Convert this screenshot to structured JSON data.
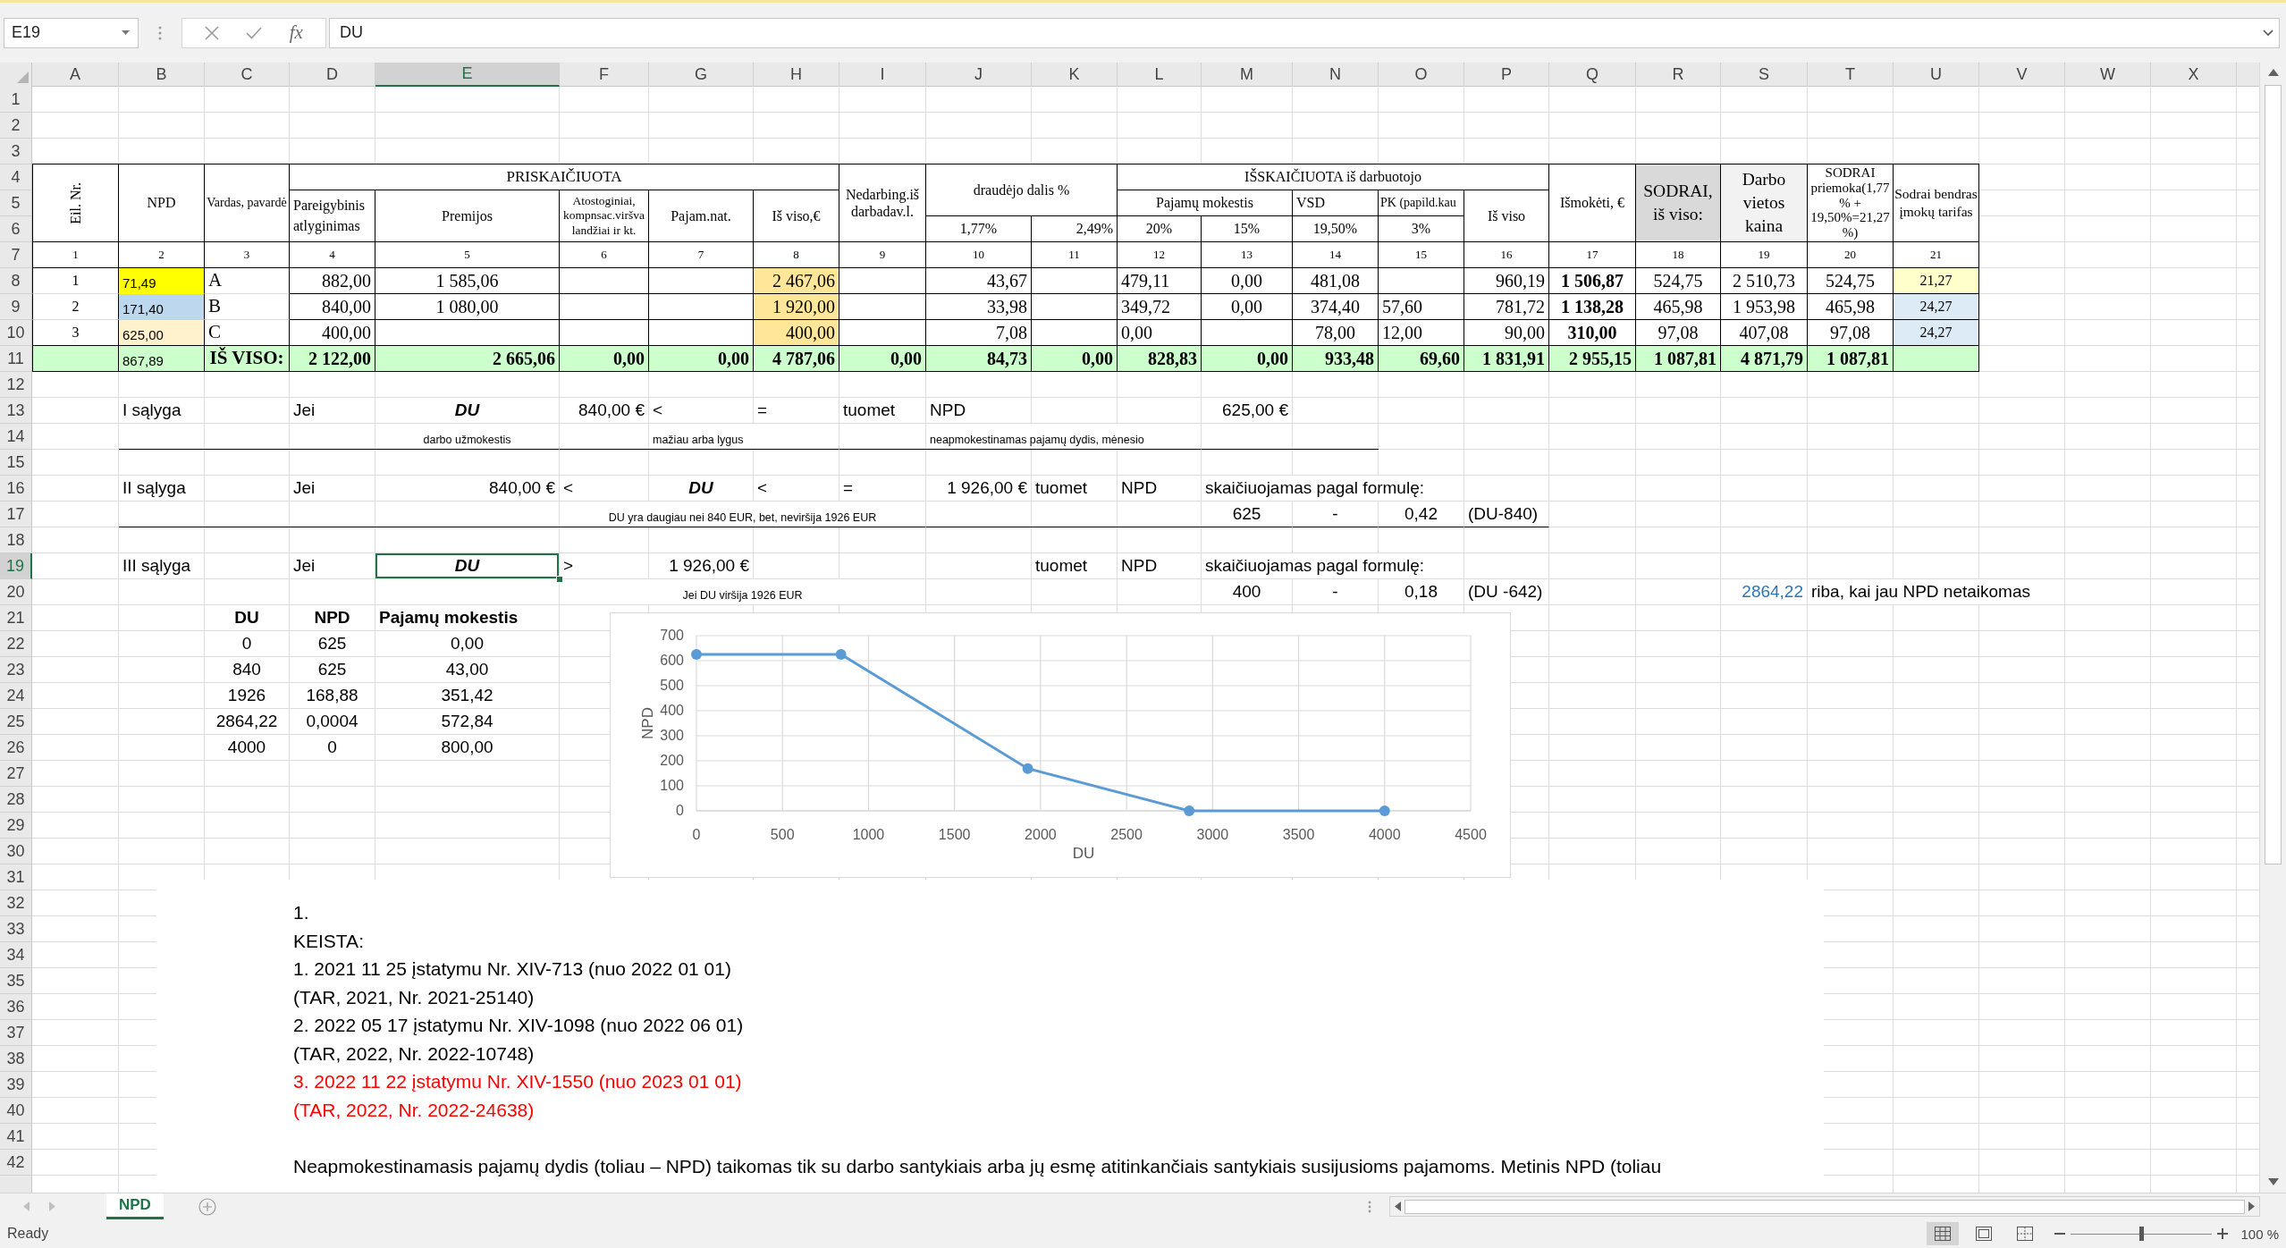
{
  "formula_bar": {
    "name_box": "E19",
    "function_label": "fx",
    "formula": "DU"
  },
  "columns": [
    {
      "label": "A",
      "selected": false
    },
    {
      "label": "B",
      "selected": false
    },
    {
      "label": "C",
      "selected": false
    },
    {
      "label": "D",
      "selected": false
    },
    {
      "label": "E",
      "selected": true
    },
    {
      "label": "F",
      "selected": false
    },
    {
      "label": "G",
      "selected": false
    },
    {
      "label": "H",
      "selected": false
    },
    {
      "label": "I",
      "selected": false
    },
    {
      "label": "J",
      "selected": false
    },
    {
      "label": "K",
      "selected": false
    },
    {
      "label": "L",
      "selected": false
    },
    {
      "label": "M",
      "selected": false
    },
    {
      "label": "N",
      "selected": false
    },
    {
      "label": "O",
      "selected": false
    },
    {
      "label": "P",
      "selected": false
    },
    {
      "label": "Q",
      "selected": false
    },
    {
      "label": "R",
      "selected": false
    },
    {
      "label": "S",
      "selected": false
    },
    {
      "label": "T",
      "selected": false
    },
    {
      "label": "U",
      "selected": false
    },
    {
      "label": "V",
      "selected": false
    },
    {
      "label": "W",
      "selected": false
    },
    {
      "label": "X",
      "selected": false
    }
  ],
  "rows": [
    {
      "label": "1",
      "selected": false
    },
    {
      "label": "2",
      "selected": false
    },
    {
      "label": "3",
      "selected": false
    },
    {
      "label": "4",
      "selected": false
    },
    {
      "label": "5",
      "selected": false
    },
    {
      "label": "6",
      "selected": false
    },
    {
      "label": "7",
      "selected": false
    },
    {
      "label": "8",
      "selected": false
    },
    {
      "label": "9",
      "selected": false
    },
    {
      "label": "10",
      "selected": false
    },
    {
      "label": "11",
      "selected": false
    },
    {
      "label": "12",
      "selected": false
    },
    {
      "label": "13",
      "selected": false
    },
    {
      "label": "14",
      "selected": false
    },
    {
      "label": "15",
      "selected": false
    },
    {
      "label": "16",
      "selected": false
    },
    {
      "label": "17",
      "selected": false
    },
    {
      "label": "18",
      "selected": false
    },
    {
      "label": "19",
      "selected": true
    },
    {
      "label": "20",
      "selected": false
    },
    {
      "label": "21",
      "selected": false
    },
    {
      "label": "22",
      "selected": false
    },
    {
      "label": "23",
      "selected": false
    },
    {
      "label": "24",
      "selected": false
    },
    {
      "label": "25",
      "selected": false
    },
    {
      "label": "26",
      "selected": false
    },
    {
      "label": "27",
      "selected": false
    },
    {
      "label": "28",
      "selected": false
    },
    {
      "label": "29",
      "selected": false
    },
    {
      "label": "30",
      "selected": false
    },
    {
      "label": "31",
      "selected": false
    },
    {
      "label": "32",
      "selected": false
    },
    {
      "label": "33",
      "selected": false
    },
    {
      "label": "34",
      "selected": false
    },
    {
      "label": "35",
      "selected": false
    },
    {
      "label": "36",
      "selected": false
    },
    {
      "label": "37",
      "selected": false
    },
    {
      "label": "38",
      "selected": false
    },
    {
      "label": "39",
      "selected": false
    },
    {
      "label": "40",
      "selected": false
    },
    {
      "label": "41",
      "selected": false
    },
    {
      "label": "42",
      "selected": false
    }
  ],
  "payroll_table": {
    "headers": [
      "Eil. Nr.",
      "NPD",
      "Vardas, pavardė",
      "PRISKAIČIUOTA",
      "Nedarbing.iš darbadav.l.",
      "draudėjo dalis %",
      "IŠSKAIČIUOTA iš darbuotojo",
      "Išmokėti, €",
      "SODRAI, iš viso:",
      "Darbo vietos kaina",
      "SODRAI priemoka(1,77 % + 19,50%=21,27 %)",
      "Sodrai bendras įmokų tarifas"
    ],
    "subheaders": [
      "Pareigybinis atlyginimas",
      "Premijos",
      "Atostoginiai, kompnsac.viršva landžiai ir kt.",
      "Pajam.nat.",
      "Iš viso,€",
      "Pajamų mokestis",
      "VSD",
      "PK (papild.kau",
      "Iš viso"
    ],
    "rate_headers": [
      "1,77%",
      "2,49%",
      "20%",
      "15%",
      "19,50%",
      "3%"
    ],
    "column_numbers": [
      "1",
      "2",
      "3",
      "4",
      "5",
      "6",
      "7",
      "8",
      "9",
      "10",
      "11",
      "12",
      "13",
      "14",
      "15",
      "16",
      "17",
      "18",
      "19",
      "20",
      "21"
    ],
    "rows": [
      {
        "no": "1",
        "npd": {
          "text": "71,49",
          "color": "#ffff00"
        },
        "name": "A",
        "base_salary": "882,00",
        "bonuses": "1 585,06",
        "total_accrued": "2 467,06",
        "employer_share_1_77": "43,67",
        "income_tax_20": "479,11",
        "income_tax_15": "0,00",
        "vsd": "481,08",
        "total_deducted": "960,19",
        "paid_out": "1 506,87",
        "sodra_total": "524,75",
        "workplace_cost": "2 510,73",
        "sodra_surcharge": "524,75",
        "sodra_rate": {
          "text": "21,27",
          "color": "#ffffcc"
        }
      },
      {
        "no": "2",
        "npd": {
          "text": "171,40",
          "color": "#bdd7ee"
        },
        "name": "B",
        "base_salary": "840,00",
        "bonuses": "1 080,00",
        "total_accrued": "1 920,00",
        "employer_share_1_77": "33,98",
        "income_tax_20": "349,72",
        "income_tax_15": "0,00",
        "vsd": "374,40",
        "pension_extra": "57,60",
        "total_deducted": "781,72",
        "paid_out": "1 138,28",
        "sodra_total": "465,98",
        "workplace_cost": "1 953,98",
        "sodra_surcharge": "465,98",
        "sodra_rate": {
          "text": "24,27",
          "color": "#ddebf7"
        }
      },
      {
        "no": "3",
        "npd": {
          "text": "625,00",
          "color": "#fff2cc"
        },
        "name": "C",
        "base_salary": "400,00",
        "total_accrued": "400,00",
        "employer_share_1_77": "7,08",
        "income_tax_20": "0,00",
        "vsd": "78,00",
        "pension_extra": "12,00",
        "total_deducted": "90,00",
        "paid_out": "310,00",
        "sodra_total": "97,08",
        "workplace_cost": "407,08",
        "sodra_surcharge": "97,08",
        "sodra_rate": {
          "text": "24,27",
          "color": "#ddebf7"
        }
      }
    ],
    "total": {
      "npd": "867,89",
      "label": "IŠ VISO:",
      "base_salary": "2 122,00",
      "bonuses": "2 665,06",
      "vacation_pay": "0,00",
      "in_kind": "0,00",
      "total_accrued": "4 787,06",
      "sick_pay": "0,00",
      "employer_share_1_77": "84,73",
      "employer_share_2_49": "0,00",
      "income_tax_20": "828,83",
      "income_tax_15": "0,00",
      "vsd": "933,48",
      "pension_extra": "69,60",
      "total_deducted": "1 831,91",
      "paid_out": "2 955,15",
      "sodra_total": "1 087,81",
      "workplace_cost": "4 871,79",
      "sodra_surcharge": "1 087,81"
    }
  },
  "conditions": [
    {
      "cells": [
        "I sąlyga",
        "Jei",
        "DU",
        "840,00 €",
        "<",
        "=",
        "tuomet",
        "NPD",
        "625,00 €"
      ],
      "notes": [
        "darbo užmokestis",
        "mažiau arba lygus",
        "neapmokestinamas pajamų dydis, mėnesio"
      ]
    },
    {
      "cells": [
        "II sąlyga",
        "Jei",
        "840,00 €",
        "<",
        "DU",
        "<",
        "=",
        "1 926,00 €",
        "tuomet",
        "NPD",
        "skaičiuojamas pagal formulę:"
      ],
      "notes": [
        "DU yra daugiau nei 840 EUR, bet, neviršija 1926 EUR"
      ],
      "formula": [
        "625",
        "-",
        "0,42",
        "(DU-840)"
      ]
    },
    {
      "cells": [
        "III sąlyga",
        "Jei",
        "DU",
        ">",
        "1 926,00 €",
        "tuomet",
        "NPD",
        "skaičiuojamas pagal formulę:"
      ],
      "notes": [
        "Jei DU viršija 1926 EUR"
      ],
      "formula": [
        "400",
        "-",
        "0,18",
        "(DU -642)"
      ],
      "threshold": {
        "value": "2864,22",
        "text": "riba, kai jau NPD netaikomas"
      }
    }
  ],
  "npd_table": {
    "columns": [
      "DU",
      "NPD",
      "Pajamų mokestis"
    ],
    "rows": [
      [
        "0",
        "625",
        "0,00"
      ],
      [
        "840",
        "625",
        "43,00"
      ],
      [
        "1926",
        "168,88",
        "351,42"
      ],
      [
        "2864,22",
        "0,0004",
        "572,84"
      ],
      [
        "4000",
        "0",
        "800,00"
      ]
    ]
  },
  "npd_chart": {
    "chart_data": {
      "type": "line",
      "xlabel": "DU",
      "ylabel": "NPD",
      "x": [
        0,
        840,
        1926,
        2864.22,
        4000
      ],
      "series": [
        {
          "color": "#5b9bd5",
          "marker": "circle",
          "values": [
            625,
            625,
            169,
            0,
            0
          ]
        }
      ],
      "xlim": [
        0,
        4500
      ],
      "ylim": [
        0,
        700
      ],
      "xticks": [
        0,
        500,
        1000,
        1500,
        2000,
        2500,
        3000,
        3500,
        4000,
        4500
      ],
      "yticks": [
        0,
        100,
        200,
        300,
        400,
        500,
        600,
        700
      ],
      "grid": true
    }
  },
  "note": {
    "lines": [
      {
        "text": "1.",
        "color": "#000000"
      },
      {
        "text": "KEISTA:",
        "color": "#000000"
      },
      {
        "text": "1. 2021 11 25 įstatymu Nr. XIV-713 (nuo 2022 01 01)",
        "color": "#000000"
      },
      {
        "text": "(TAR, 2021, Nr. 2021-25140)",
        "color": "#000000"
      },
      {
        "text": "2. 2022 05 17 įstatymu Nr. XIV-1098 (nuo 2022 06 01)",
        "color": "#000000"
      },
      {
        "text": "(TAR, 2022, Nr. 2022-10748)",
        "color": "#000000"
      },
      {
        "text": "3. 2022 11 22 įstatymu Nr. XIV-1550 (nuo 2023 01 01)",
        "color": "#ff0000"
      },
      {
        "text": "(TAR, 2022, Nr. 2022-24638)",
        "color": "#ff0000"
      }
    ],
    "paragraph": "Neapmokestinamasis pajamų dydis (toliau – NPD) taikomas tik su darbo santykiais arba jų esmę atitinkančiais santykiais susijusioms pajamoms. Metinis NPD (toliau"
  },
  "sheet_tabs": [
    {
      "label": "NPD",
      "selected": true
    }
  ],
  "status_bar": {
    "status": "Ready",
    "view_modes": [
      {
        "kind": "normal",
        "selected": true
      },
      {
        "kind": "page_layout",
        "selected": false
      },
      {
        "kind": "page_break",
        "selected": false
      }
    ],
    "zoom_slider": {
      "level": 0.5
    },
    "zoom": "100 %"
  }
}
